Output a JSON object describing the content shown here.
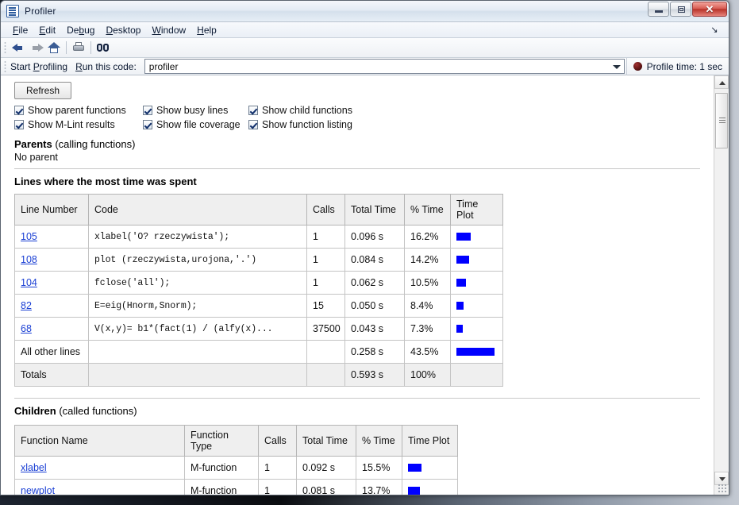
{
  "window": {
    "title": "Profiler",
    "icon": "document-lines-icon",
    "buttons": {
      "minimize": "minimize",
      "maximize": "maximize",
      "close": "✕"
    }
  },
  "menu": {
    "items": [
      "File",
      "Edit",
      "Debug",
      "Desktop",
      "Window",
      "Help"
    ],
    "undock_icon": "undock-arrow-icon"
  },
  "toolbar": {
    "back": "back-arrow-icon",
    "forward": "forward-arrow-icon",
    "home": "home-icon",
    "print": "print-icon",
    "find": "find-binoculars-icon"
  },
  "runbar": {
    "start_profiling": "Start Profiling",
    "run_this_code": "Run this code:",
    "code_value": "profiler",
    "code_placeholder": "profiler",
    "profile_time": "Profile time: 1 sec",
    "record_icon": "record-dot-icon"
  },
  "controls": {
    "refresh": "Refresh",
    "checkboxes": [
      {
        "label": "Show parent functions",
        "checked": true
      },
      {
        "label": "Show busy lines",
        "checked": true
      },
      {
        "label": "Show child functions",
        "checked": true
      },
      {
        "label": "Show M-Lint results",
        "checked": true
      },
      {
        "label": "Show file coverage",
        "checked": true
      },
      {
        "label": "Show function listing",
        "checked": true
      }
    ]
  },
  "parents": {
    "heading_bold": "Parents",
    "heading_rest": " (calling functions)",
    "note": "No parent"
  },
  "lines_section": {
    "title": "Lines where the most time was spent",
    "columns": [
      "Line Number",
      "Code",
      "Calls",
      "Total Time",
      "% Time",
      "Time Plot"
    ],
    "rows": [
      {
        "line": "105",
        "code": "xlabel('O? rzeczywista');",
        "calls": "1",
        "total_time": "0.096 s",
        "pct": "16.2%",
        "bar_pct": 16.2,
        "link": true
      },
      {
        "line": "108",
        "code": "plot (rzeczywista,urojona,'.')",
        "calls": "1",
        "total_time": "0.084 s",
        "pct": "14.2%",
        "bar_pct": 14.2,
        "link": true
      },
      {
        "line": "104",
        "code": "fclose('all');",
        "calls": "1",
        "total_time": "0.062 s",
        "pct": "10.5%",
        "bar_pct": 10.5,
        "link": true
      },
      {
        "line": "82",
        "code": "E=eig(Hnorm,Snorm);",
        "calls": "15",
        "total_time": "0.050 s",
        "pct": "8.4%",
        "bar_pct": 8.4,
        "link": true
      },
      {
        "line": "68",
        "code": "V(x,y)= b1*(fact(1) / (alfy(x)...",
        "calls": "37500",
        "total_time": "0.043 s",
        "pct": "7.3%",
        "bar_pct": 7.3,
        "link": true
      },
      {
        "line": "All other lines",
        "code": "",
        "calls": "",
        "total_time": "0.258 s",
        "pct": "43.5%",
        "bar_pct": 43.5,
        "link": false
      },
      {
        "line": "Totals",
        "code": "",
        "calls": "",
        "total_time": "0.593 s",
        "pct": "100%",
        "bar_pct": 0,
        "link": false,
        "shaded": true
      }
    ]
  },
  "children_section": {
    "heading_bold": "Children",
    "heading_rest": " (called functions)",
    "columns": [
      "Function Name",
      "Function Type",
      "Calls",
      "Total Time",
      "% Time",
      "Time Plot"
    ],
    "rows": [
      {
        "name": "xlabel",
        "type": "M-function",
        "calls": "1",
        "total_time": "0.092 s",
        "pct": "15.5%",
        "bar_pct": 15.5
      },
      {
        "name": "newplot",
        "type": "M-function",
        "calls": "1",
        "total_time": "0.081 s",
        "pct": "13.7%",
        "bar_pct": 13.7
      }
    ]
  },
  "scrollbar": {
    "up_arrow": "scroll-up-arrow-icon",
    "down_arrow": "scroll-down-arrow-icon"
  },
  "colors": {
    "bar": "#0000ff",
    "link": "#1a3fd4",
    "header_bg": "#efefef",
    "accent_title": "#14213a"
  },
  "chart_data": {
    "type": "bar",
    "title": "Time Plot (% of total time per line)",
    "categories": [
      "105",
      "108",
      "104",
      "82",
      "68",
      "All other lines"
    ],
    "values": [
      16.2,
      14.2,
      10.5,
      8.4,
      7.3,
      43.5
    ],
    "xlabel": "",
    "ylabel": "% Time",
    "ylim": [
      0,
      100
    ],
    "legend": [],
    "grid": false
  }
}
